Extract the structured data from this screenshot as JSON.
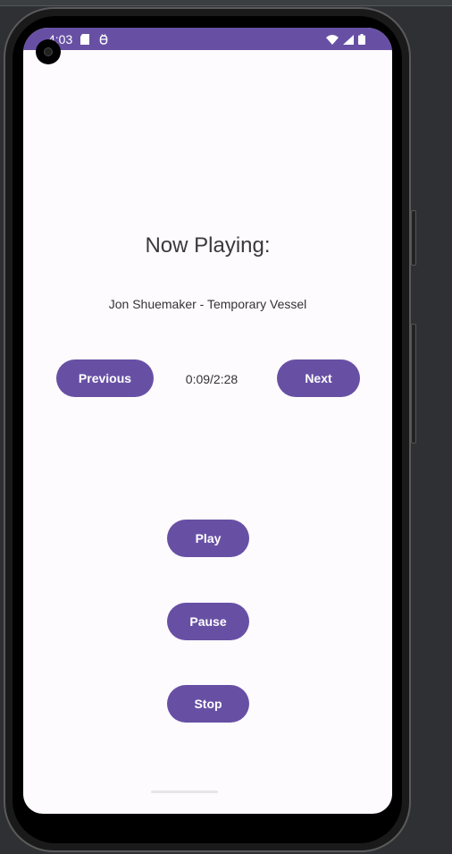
{
  "status_bar": {
    "time": "4:03",
    "left_icons": [
      "sd-card-icon",
      "debug-icon"
    ],
    "right_icons": [
      "wifi-icon",
      "signal-icon",
      "battery-icon"
    ],
    "color": "#6750a4"
  },
  "player": {
    "heading": "Now Playing:",
    "track": "Jon Shuemaker - Temporary Vessel",
    "time": "0:09/2:28",
    "previous_label": "Previous",
    "next_label": "Next",
    "play_label": "Play",
    "pause_label": "Pause",
    "stop_label": "Stop"
  },
  "theme": {
    "accent": "#6750a4",
    "background": "#fefbff"
  }
}
